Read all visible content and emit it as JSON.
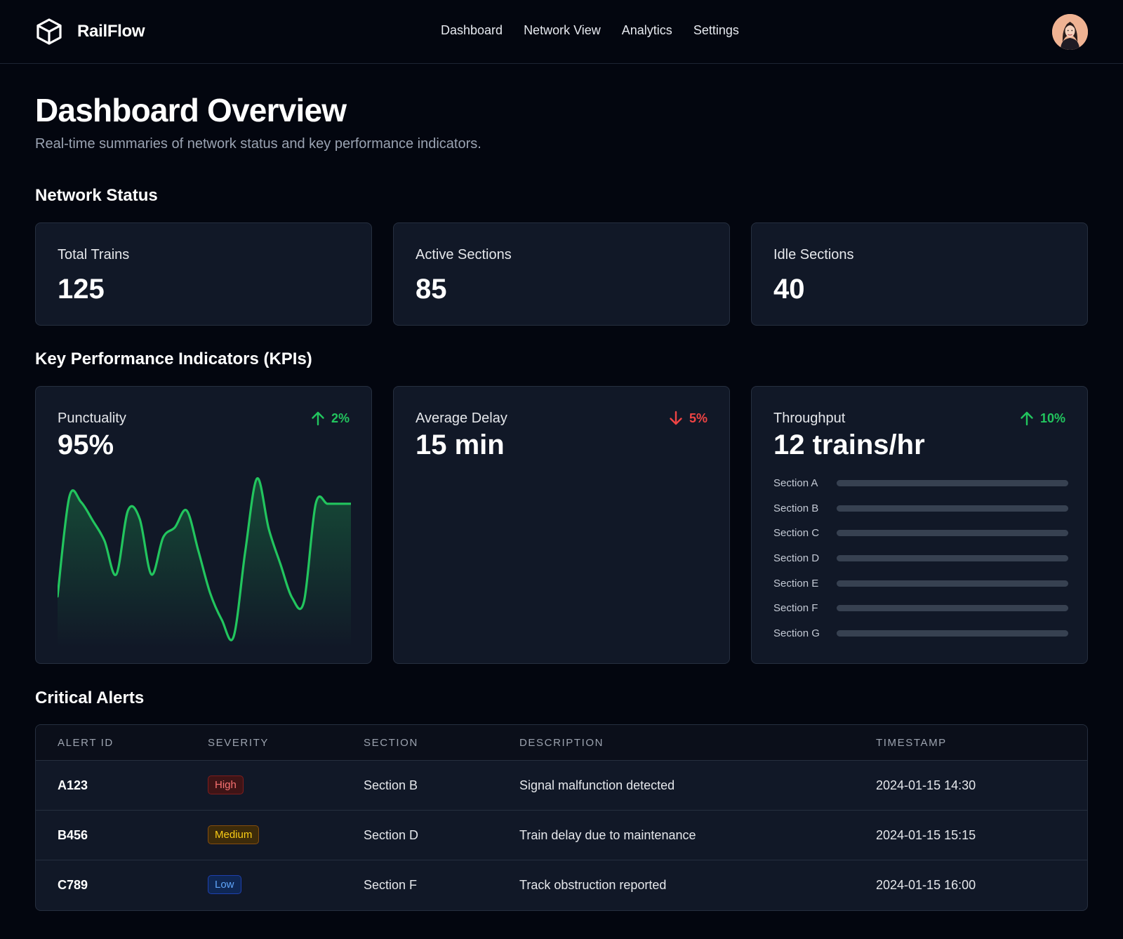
{
  "app": {
    "brand": "RailFlow",
    "icon": "cube-icon"
  },
  "nav": {
    "items": [
      {
        "label": "Dashboard"
      },
      {
        "label": "Network View"
      },
      {
        "label": "Analytics"
      },
      {
        "label": "Settings"
      }
    ]
  },
  "page": {
    "title": "Dashboard Overview",
    "subtitle": "Real-time summaries of network status and key performance indicators."
  },
  "network_status": {
    "heading": "Network Status",
    "cards": [
      {
        "label": "Total Trains",
        "value": "125"
      },
      {
        "label": "Active Sections",
        "value": "85"
      },
      {
        "label": "Idle Sections",
        "value": "40"
      }
    ]
  },
  "kpis": {
    "heading": "Key Performance Indicators (KPIs)",
    "punctuality": {
      "label": "Punctuality",
      "value": "95%",
      "change": "2%",
      "direction": "up",
      "icon": "arrow-up-icon"
    },
    "average_delay": {
      "label": "Average Delay",
      "value": "15 min",
      "change": "5%",
      "direction": "down",
      "icon": "arrow-down-icon"
    },
    "throughput": {
      "label": "Throughput",
      "value": "12 trains/hr",
      "change": "10%",
      "direction": "up",
      "icon": "arrow-up-icon",
      "sections": [
        {
          "name": "Section A",
          "fill": 1.0
        },
        {
          "name": "Section B",
          "fill": 1.0
        },
        {
          "name": "Section C",
          "fill": 1.0
        },
        {
          "name": "Section D",
          "fill": 1.0
        },
        {
          "name": "Section E",
          "fill": 1.0
        },
        {
          "name": "Section F",
          "fill": 1.0
        },
        {
          "name": "Section G",
          "fill": 1.0
        }
      ]
    }
  },
  "chart_data": {
    "type": "area",
    "title": "",
    "xlabel": "",
    "ylabel": "",
    "x": [
      0,
      1,
      2,
      3,
      4,
      5,
      6,
      7,
      8,
      9,
      10,
      11,
      12,
      13,
      14,
      15,
      16,
      17,
      18,
      19,
      20,
      21,
      22,
      23,
      24,
      25
    ],
    "series": [
      {
        "values": [
          0.28,
          0.87,
          0.84,
          0.73,
          0.61,
          0.41,
          0.79,
          0.74,
          0.41,
          0.63,
          0.69,
          0.79,
          0.55,
          0.3,
          0.14,
          0.04,
          0.55,
          0.98,
          0.68,
          0.47,
          0.27,
          0.25,
          0.83,
          0.83,
          0.83,
          0.83
        ]
      }
    ],
    "ylim": [
      0,
      1
    ],
    "grid": false,
    "colors": {
      "line": "#22c55e"
    }
  },
  "alerts": {
    "heading": "Critical Alerts",
    "columns": [
      "ALERT ID",
      "SEVERITY",
      "SECTION",
      "DESCRIPTION",
      "TIMESTAMP"
    ],
    "rows": [
      {
        "id": "A123",
        "severity": "High",
        "level": "high",
        "section": "Section B",
        "description": "Signal malfunction detected",
        "timestamp": "2024-01-15 14:30"
      },
      {
        "id": "B456",
        "severity": "Medium",
        "level": "medium",
        "section": "Section D",
        "description": "Train delay due to maintenance",
        "timestamp": "2024-01-15 15:15"
      },
      {
        "id": "C789",
        "severity": "Low",
        "level": "low",
        "section": "Section F",
        "description": "Track obstruction reported",
        "timestamp": "2024-01-15 16:00"
      }
    ]
  },
  "colors": {
    "background": "#03060f",
    "card": "#111827",
    "accent_up": "#22c55e",
    "accent_down": "#ef4444"
  }
}
